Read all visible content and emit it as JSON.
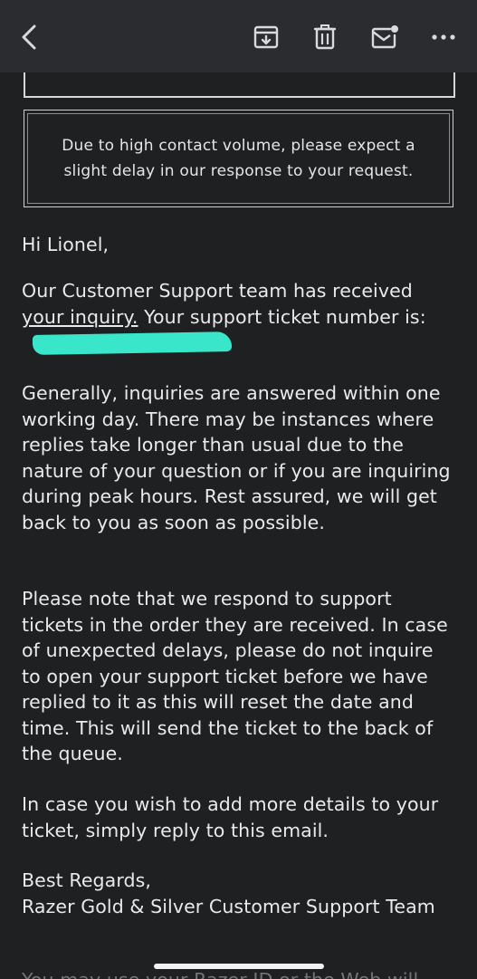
{
  "toolbar": {
    "back": "back-icon",
    "archive": "archive-icon",
    "delete": "trash-icon",
    "mark_unread": "mark-unread-icon",
    "more": "more-icon"
  },
  "email": {
    "notice": "Due to high contact volume, please expect a slight delay in our response to your request.",
    "greeting": "Hi Lionel,",
    "p1_a": "Our Customer Support team has received ",
    "p1_link": "your inquiry.",
    "p1_b": "  Your support ticket number is:",
    "p2": "Generally, inquiries are answered within one working day.  There may be instances where replies take longer than usual due to the nature of your question or if you are inquiring during peak hours.  Rest assured, we will get back to you as soon as possible.",
    "p3": "Please note that we respond to support tickets in the order they are received.  In case of unexpected delays, please do not inquire to open your support ticket before we have replied to it as this will reset the date and time.  This will send the ticket to the back of the queue.",
    "p4": "In case you wish to add more details to your ticket, simply reply to this email.",
    "signoff": "Best Regards,",
    "signature": "Razer Gold & Silver Customer Support Team",
    "cutoff": "You may use your Razer ID or the Web will"
  },
  "colors": {
    "toolbar_bg": "#2a2c2f",
    "body_bg": "#1e2022",
    "text": "#e9eaec",
    "redaction": "#39e6c9"
  }
}
